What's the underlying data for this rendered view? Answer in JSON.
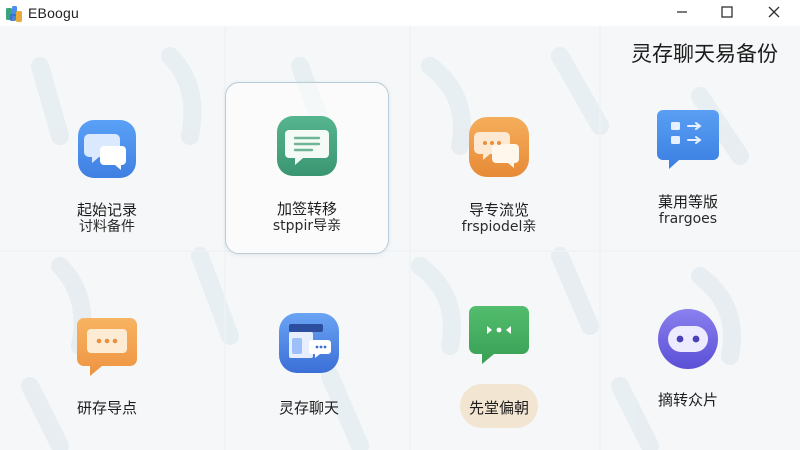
{
  "window": {
    "app_name": "EBoogu",
    "min_label": "minimize",
    "max_label": "maximize",
    "close_label": "close"
  },
  "page": {
    "title": "灵存聊天易备份"
  },
  "tiles": [
    {
      "id": "t1",
      "line1": "起始记录",
      "line2": "讨料备件",
      "icon": "chat-bubbles-icon",
      "color": "#4a8ef0"
    },
    {
      "id": "t2",
      "line1": "加签转移",
      "line2": "stppir导亲",
      "icon": "message-lines-icon",
      "color": "#42a37f",
      "selected": true
    },
    {
      "id": "t3",
      "line1": "导专流览",
      "line2": "frspiodel亲",
      "icon": "chat-dots-icon",
      "color": "#ee9a42"
    },
    {
      "id": "t4",
      "line1": "菓用等版",
      "line2": "frargoes",
      "icon": "list-arrows-icon",
      "color": "#3f86e6"
    },
    {
      "id": "t5",
      "line1": "研存导点",
      "line2": "",
      "icon": "chat-dots-icon",
      "color": "#f0a44e"
    },
    {
      "id": "t6",
      "line1": "灵存聊天",
      "line2": "",
      "icon": "window-chat-icon",
      "color": "#4c7fe0"
    },
    {
      "id": "t7",
      "line1": "先堂偏朝",
      "line2": "",
      "icon": "chat-dots-icon",
      "color": "#3fae60"
    },
    {
      "id": "t8",
      "line1": "摘转众片",
      "line2": "",
      "icon": "face-icon",
      "color": "#6f62e0"
    }
  ]
}
